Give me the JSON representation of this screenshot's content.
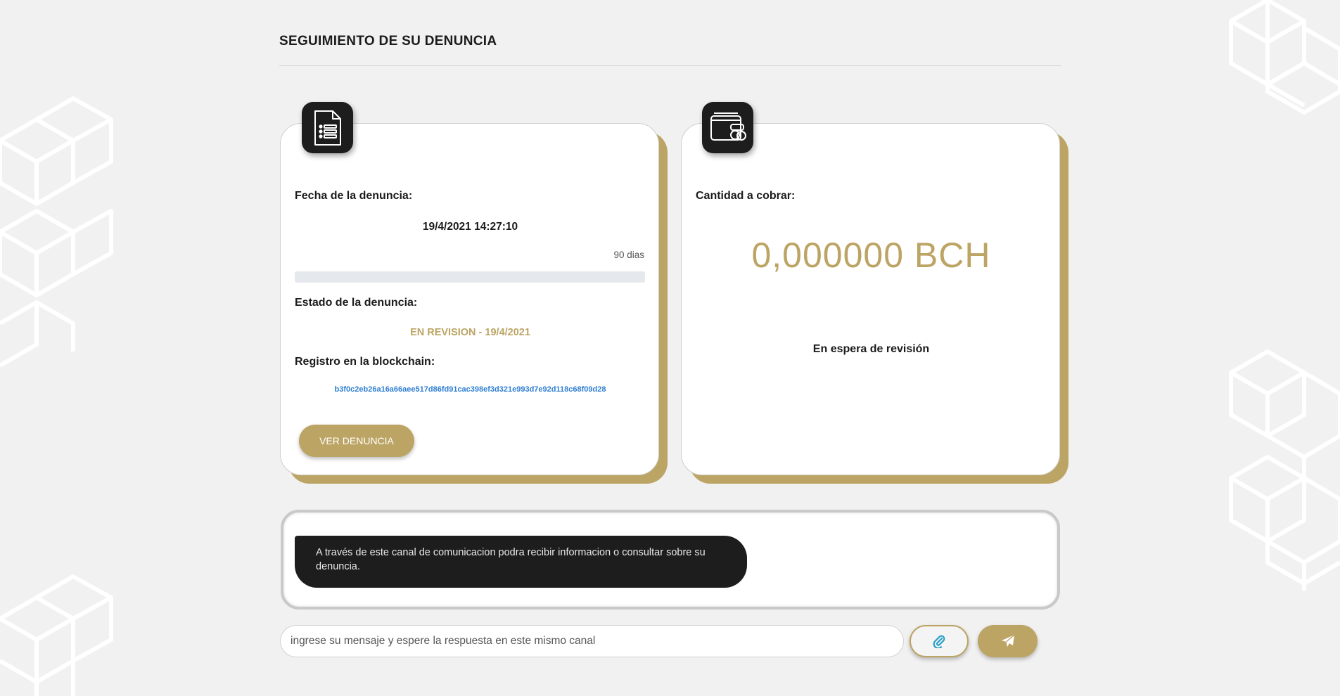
{
  "page": {
    "title": "SEGUIMIENTO DE SU DENUNCIA"
  },
  "colors": {
    "accent_gold": "#bca464",
    "dark": "#1d1d1d",
    "background": "#f1f1f1",
    "link_blue": "#2f7fd3"
  },
  "report_card": {
    "icon": "document-list-icon",
    "date_label": "Fecha de la denuncia:",
    "date_value": "19/4/2021 14:27:10",
    "days_label": "90 dias",
    "progress_percent": 0,
    "status_label": "Estado de la denuncia:",
    "status_value": "EN REVISION - 19/4/2021",
    "blockchain_label": "Registro en la blockchain:",
    "blockchain_hash": "b3f0c2eb26a16a66aee517d86fd91cac398ef3d321e993d7e92d118c68f09d28",
    "view_button": "VER DENUNCIA"
  },
  "payment_card": {
    "icon": "wallet-coins-icon",
    "amount_label": "Cantidad a cobrar:",
    "amount_value": "0,000000 BCH",
    "status_text": "En espera de revisión"
  },
  "chat": {
    "messages": [
      {
        "text": "A través de este canal de comunicacion podra recibir informacion o consultar sobre su denuncia."
      }
    ],
    "input_placeholder": "ingrese su mensaje y espere la respuesta en este mismo canal",
    "attach_icon": "paperclip-icon",
    "send_icon": "paper-plane-icon"
  }
}
